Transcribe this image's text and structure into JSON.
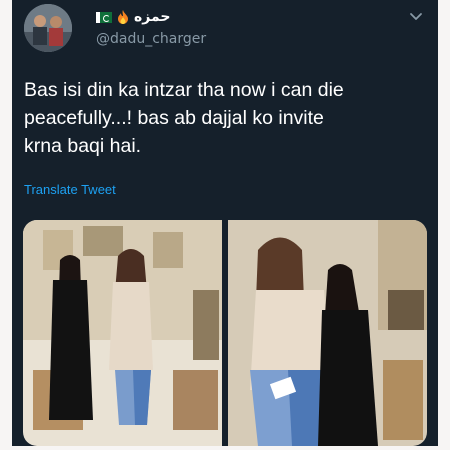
{
  "tweet": {
    "display_name": "حمزه",
    "handle": "@dadu_charger",
    "text_lines": [
      "Bas isi din ka intzar tha now i can die",
      "peacefully...! bas ab dajjal ko invite",
      "krna baqi hai."
    ],
    "translate_label": "Translate Tweet"
  },
  "icons": [
    "avatar",
    "pakistan-flag-icon",
    "fire-icon",
    "chevron-down-icon"
  ],
  "colors": {
    "background": "#15202b",
    "text": "#ffffff",
    "secondary_text": "#8899a6",
    "link": "#1da1f2"
  }
}
